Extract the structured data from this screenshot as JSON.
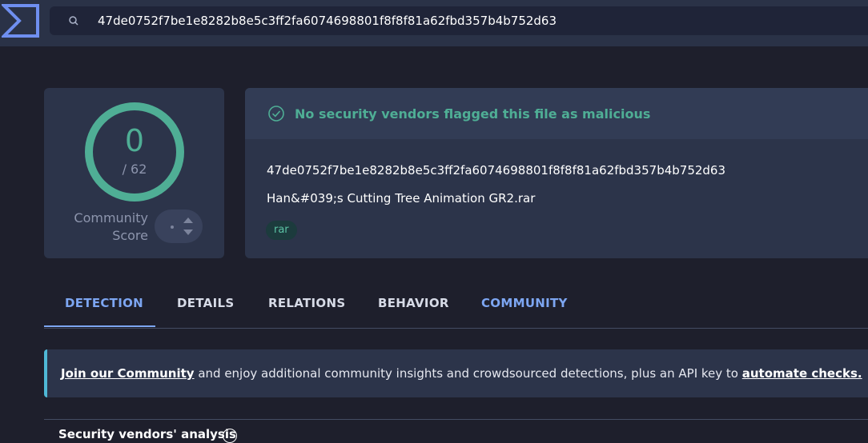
{
  "search": {
    "value": "47de0752f7be1e8282b8e5c3ff2fa6074698801f8f8f81a62fbd357b4b752d63"
  },
  "score": {
    "value": "0",
    "total": "/ 62",
    "community_label_line1": "Community",
    "community_label_line2": "Score",
    "ring_color": "#4fae95"
  },
  "verdict": {
    "text": "No security vendors flagged this file as malicious",
    "color": "#4fae95"
  },
  "file": {
    "hash": "47de0752f7be1e8282b8e5c3ff2fa6074698801f8f8f81a62fbd357b4b752d63",
    "name": "Han&#039;s Cutting Tree Animation GR2.rar",
    "tags": [
      "rar"
    ]
  },
  "tabs": [
    {
      "label": "DETECTION"
    },
    {
      "label": "DETAILS"
    },
    {
      "label": "RELATIONS"
    },
    {
      "label": "BEHAVIOR"
    },
    {
      "label": "COMMUNITY"
    }
  ],
  "banner": {
    "link1": "Join our Community",
    "text": " and enjoy additional community insights and crowdsourced detections, plus an API key to ",
    "link2": "automate checks."
  },
  "section": {
    "title": "Security vendors' analysis"
  },
  "icons": {
    "logo": "virustotal-sigma-logo",
    "search": "search-icon",
    "check": "check-circle-icon",
    "help": "info-circle-icon"
  },
  "colors": {
    "accent": "#7da6f2",
    "success": "#4fae95",
    "banner_border": "#4fb8d6"
  }
}
